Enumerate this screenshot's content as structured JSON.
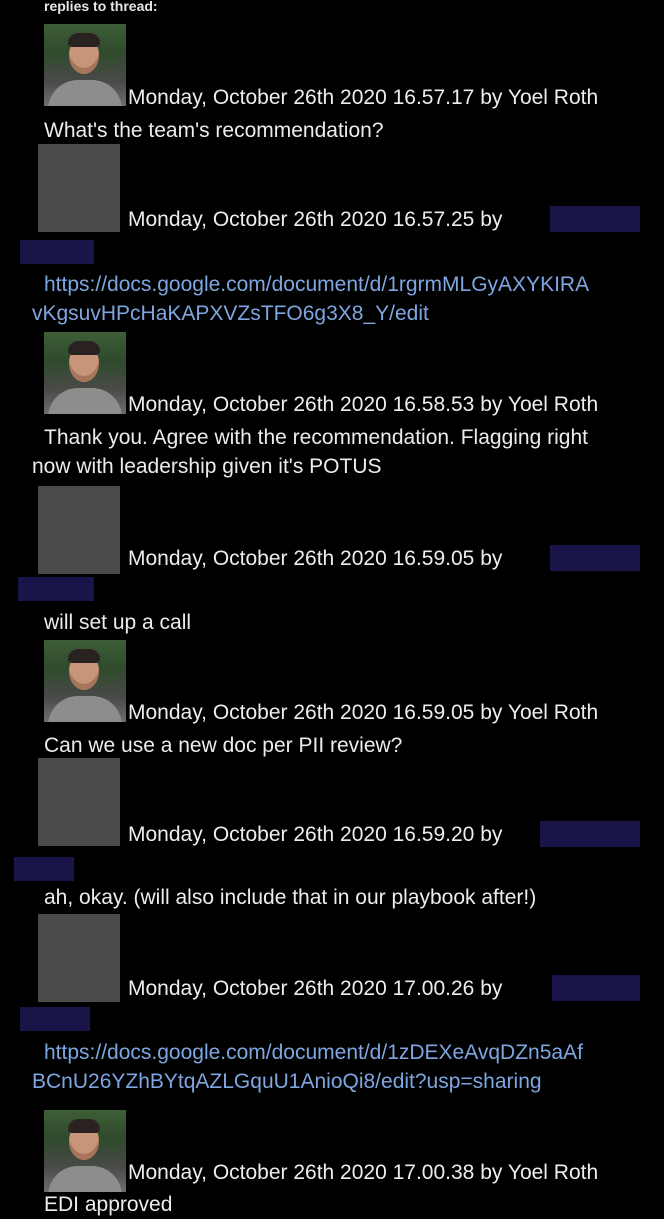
{
  "thread": {
    "heading": "replies to thread:",
    "replies": [
      {
        "timestamp": "Monday, October 26th 2020 16.57.17",
        "author": "Yoel Roth",
        "text": "What's the team's recommendation?"
      },
      {
        "timestamp": "Monday, October 26th 2020 16.57.25",
        "author": "",
        "link_line1": "https://docs.google.com/document/d/1rgrmMLGyAXYKIRA",
        "link_line2": "vKgsuvHPcHaKAPXVZsTFO6g3X8_Y/edit"
      },
      {
        "timestamp": "Monday, October 26th 2020 16.58.53",
        "author": "Yoel Roth",
        "text_line1": "Thank you. Agree with the recommendation. Flagging right",
        "text_line2": "now with leadership given it's POTUS"
      },
      {
        "timestamp": "Monday, October 26th 2020 16.59.05",
        "author": "",
        "text": "will set up a call"
      },
      {
        "timestamp": "Monday, October 26th 2020 16.59.05",
        "author": "Yoel Roth",
        "text": "Can we use a new doc per PII review?"
      },
      {
        "timestamp": "Monday, October 26th 2020 16.59.20",
        "author": "",
        "text": "ah, okay. (will also include that in our playbook after!)"
      },
      {
        "timestamp": "Monday, October 26th 2020 17.00.26",
        "author": "",
        "link_line1": "https://docs.google.com/document/d/1zDEXeAvqDZn5aAf",
        "link_line2": "BCnU26YZhBYtqAZLGquU1AnioQi8/edit?usp=sharing"
      },
      {
        "timestamp": "Monday, October 26th 2020 17.00.38",
        "author": "Yoel Roth",
        "text": "EDI approved"
      }
    ]
  },
  "labels": {
    "by": "by"
  },
  "colors": {
    "background": "#000000",
    "text": "#ececec",
    "link": "#7ea6e0",
    "redaction": "#1a1548",
    "blank_avatar": "#4a4a4a"
  }
}
